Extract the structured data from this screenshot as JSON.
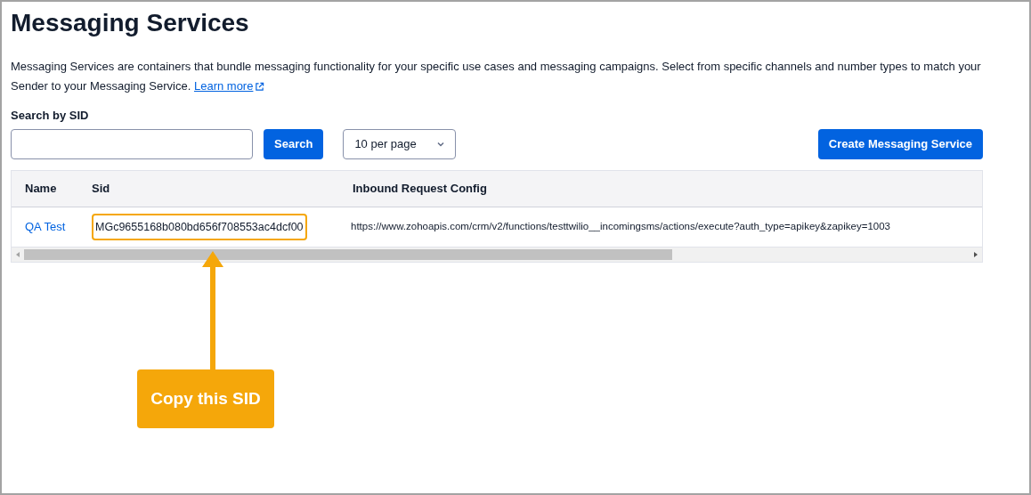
{
  "page": {
    "title": "Messaging Services",
    "description": "Messaging Services are containers that bundle messaging functionality for your specific use cases and messaging campaigns. Select from specific channels and number types to match your Sender to your Messaging Service.",
    "learn_more": "Learn more"
  },
  "search": {
    "label": "Search by SID",
    "button": "Search",
    "page_size": "10 per page",
    "create_button": "Create Messaging Service"
  },
  "table": {
    "columns": [
      "Name",
      "Sid",
      "Inbound Request Config"
    ],
    "rows": [
      {
        "name": "QA Test",
        "sid": "MGc9655168b080bd656f708553ac4dcf00",
        "inbound_request_config": "https://www.zohoapis.com/crm/v2/functions/testtwilio__incomingsms/actions/execute?auth_type=apikey&zapikey=1003"
      }
    ]
  },
  "callout": {
    "text": "Copy this SID"
  }
}
